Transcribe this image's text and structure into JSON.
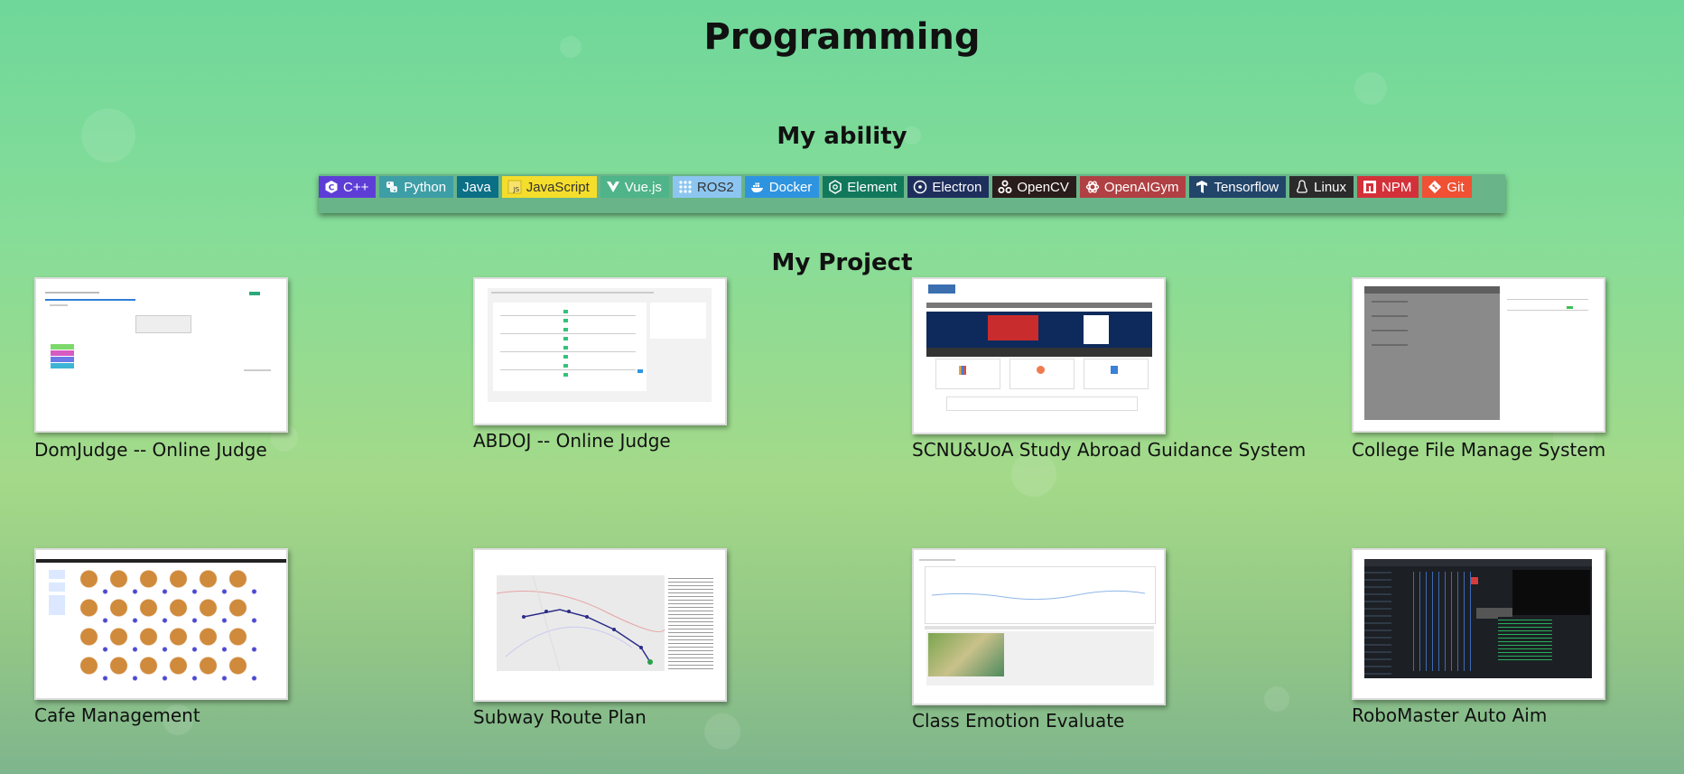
{
  "page": {
    "title": "Programming",
    "ability_heading": "My ability",
    "project_heading": "My Project"
  },
  "badges": [
    {
      "label": "C++",
      "icon": "cplusplus-icon",
      "color": "#5e3dd6"
    },
    {
      "label": "Python",
      "icon": "python-icon",
      "color": "#3e9ea6"
    },
    {
      "label": "Java",
      "icon": "",
      "color": "#0b6f86"
    },
    {
      "label": "JavaScript",
      "icon": "javascript-icon",
      "color": "#f5de2b",
      "text": "#333333"
    },
    {
      "label": "Vue.js",
      "icon": "vuejs-icon",
      "color": "#4fb489"
    },
    {
      "label": "ROS2",
      "icon": "ros-icon",
      "color": "#8cc6f0",
      "text": "#333333"
    },
    {
      "label": "Docker",
      "icon": "docker-icon",
      "color": "#2f94e0"
    },
    {
      "label": "Element",
      "icon": "element-icon",
      "color": "#12785c"
    },
    {
      "label": "Electron",
      "icon": "electron-icon",
      "color": "#1f2f5d"
    },
    {
      "label": "OpenCV",
      "icon": "opencv-icon",
      "color": "#2a1c1a"
    },
    {
      "label": "OpenAIGym",
      "icon": "openai-icon",
      "color": "#b04043"
    },
    {
      "label": "Tensorflow",
      "icon": "tensorflow-icon",
      "color": "#22456a"
    },
    {
      "label": "Linux",
      "icon": "linux-icon",
      "color": "#2b2b2b"
    },
    {
      "label": "NPM",
      "icon": "npm-icon",
      "color": "#d4303a"
    },
    {
      "label": "Git",
      "icon": "git-icon",
      "color": "#f05033"
    }
  ],
  "projects": [
    {
      "caption": "DomJudge -- Online Judge",
      "preview": "domjudge-screenshot"
    },
    {
      "caption": "ABDOJ -- Online Judge",
      "preview": "abdoj-screenshot"
    },
    {
      "caption": "SCNU&UoA Study Abroad Guidance System",
      "preview": "study-abroad-screenshot"
    },
    {
      "caption": "College File Manage System",
      "preview": "file-manage-screenshot"
    },
    {
      "caption": "Cafe Management",
      "preview": "cafe-screenshot"
    },
    {
      "caption": "Subway Route Plan",
      "preview": "subway-map-screenshot"
    },
    {
      "caption": "Class Emotion Evaluate",
      "preview": "emotion-chart-screenshot"
    },
    {
      "caption": "RoboMaster Auto Aim",
      "preview": "robomaster-screenshot"
    }
  ]
}
